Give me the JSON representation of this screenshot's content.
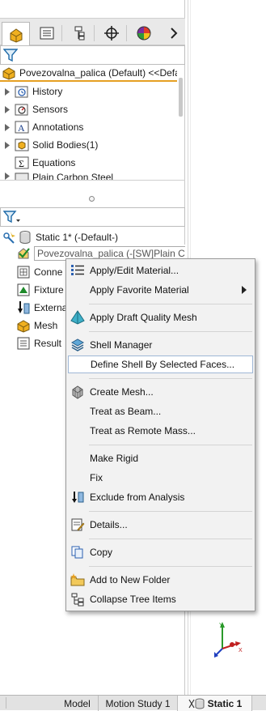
{
  "feature_manager": {
    "filter_placeholder": "",
    "root_label": "Povezovalna_palica (Default) <<Defa",
    "tree_items": [
      {
        "label": "History",
        "icon": "history-icon"
      },
      {
        "label": "Sensors",
        "icon": "sensors-icon"
      },
      {
        "label": "Annotations",
        "icon": "annotations-icon"
      },
      {
        "label": "Solid Bodies(1)",
        "icon": "solid-bodies-icon"
      },
      {
        "label": "Equations",
        "icon": "equations-icon"
      },
      {
        "label": "Plain Carbon Steel",
        "icon": "material-icon"
      }
    ]
  },
  "simulation_tree": {
    "study_label": "Static 1* (-Default-)",
    "part_label": "Povezovalna_palica (-[SW]Plain Carbon Steel-)",
    "items": [
      {
        "label": "Conne",
        "icon": "connections-icon"
      },
      {
        "label": "Fixture",
        "icon": "fixtures-icon"
      },
      {
        "label": "Externa",
        "icon": "external-loads-icon"
      },
      {
        "label": "Mesh",
        "icon": "mesh-icon"
      },
      {
        "label": "Result",
        "icon": "results-icon"
      }
    ]
  },
  "context_menu": {
    "items": [
      {
        "label": "Apply/Edit Material...",
        "icon": "material-list-icon"
      },
      {
        "label": "Apply Favorite Material",
        "submenu": true
      },
      {
        "label": "Apply Draft Quality Mesh",
        "icon": "draft-mesh-icon"
      },
      {
        "label": "Shell Manager",
        "icon": "shell-manager-icon"
      },
      {
        "label": "Define Shell By Selected Faces...",
        "highlighted": true
      },
      {
        "label": "Create Mesh...",
        "icon": "create-mesh-icon"
      },
      {
        "label": "Treat as Beam..."
      },
      {
        "label": "Treat as Remote Mass..."
      },
      {
        "label": "Make Rigid"
      },
      {
        "label": "Fix"
      },
      {
        "label": "Exclude from Analysis",
        "icon": "exclude-icon"
      },
      {
        "label": "Details...",
        "icon": "details-icon"
      },
      {
        "label": "Copy",
        "icon": "copy-icon"
      },
      {
        "label": "Add to New Folder",
        "icon": "new-folder-icon"
      },
      {
        "label": "Collapse Tree Items",
        "icon": "collapse-tree-icon"
      }
    ]
  },
  "bottom_tabs": {
    "model": "Model",
    "motion_study": "Motion Study 1",
    "static": "Static 1"
  },
  "colors": {
    "highlight_border": "#9fb7d6",
    "root_underline": "#e6a023",
    "menu_bg": "#f2f2f2"
  }
}
